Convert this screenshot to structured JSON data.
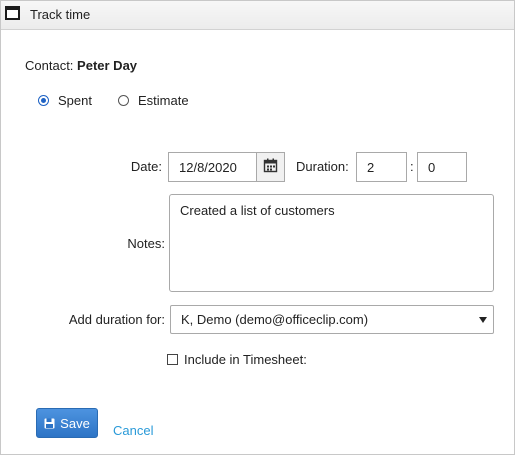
{
  "window": {
    "title": "Track time",
    "icon": "window-icon"
  },
  "contact": {
    "label": "Contact:",
    "name": "Peter Day"
  },
  "time_type": {
    "options": [
      {
        "label": "Spent",
        "checked": true
      },
      {
        "label": "Estimate",
        "checked": false
      }
    ]
  },
  "date": {
    "label": "Date:",
    "value": "12/8/2020",
    "icon": "calendar-icon"
  },
  "duration": {
    "label": "Duration:",
    "hours": "2",
    "separator": ":",
    "minutes": "0"
  },
  "notes": {
    "label": "Notes:",
    "value": "Created a list of customers"
  },
  "add_duration": {
    "label": "Add duration for:",
    "selected": "K, Demo (demo@officeclip.com)",
    "icon": "chevron-down-icon"
  },
  "timesheet": {
    "label": "Include in Timesheet:",
    "checked": false
  },
  "actions": {
    "save_label": "Save",
    "save_icon": "floppy-disk-icon",
    "cancel_label": "Cancel"
  },
  "colors": {
    "accent": "#2d74c6",
    "link": "#2a9ad8",
    "radio": "#1e62c4"
  }
}
